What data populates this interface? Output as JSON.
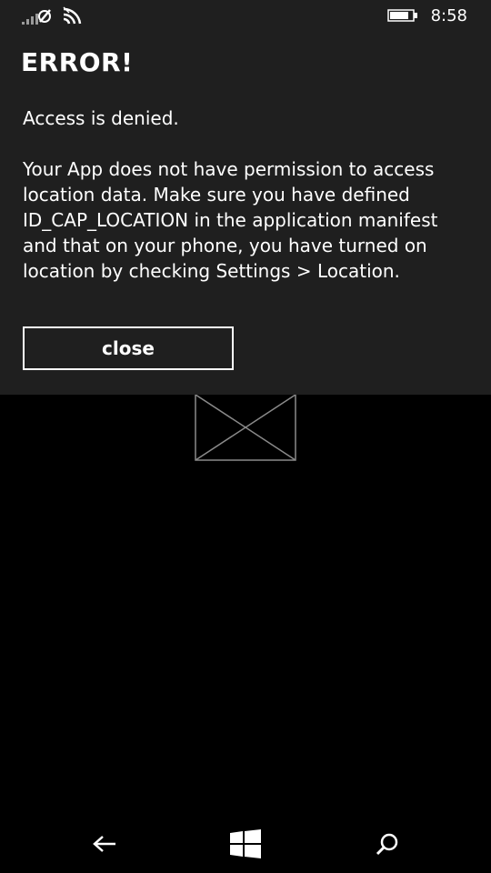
{
  "status_bar": {
    "time": "8:58",
    "icons": [
      "signal-off-icon",
      "wifi-icon",
      "battery-icon"
    ]
  },
  "dialog": {
    "title": "ERROR!",
    "message_line_1": "Access is denied.",
    "message_body": "Your App does not have permission to access location data. Make sure you have defined ID_CAP_LOCATION in the application manifest and that on your phone, you have turned on location by checking Settings > Location.",
    "close_label": "close"
  },
  "content": {
    "image_placeholder_icon": "broken-image-icon"
  },
  "nav_bar": {
    "icons": [
      "back-arrow-icon",
      "windows-start-icon",
      "search-icon"
    ]
  },
  "colors": {
    "dialog_background": "#1f1f1f",
    "page_background": "#000000",
    "text": "#ffffff"
  }
}
